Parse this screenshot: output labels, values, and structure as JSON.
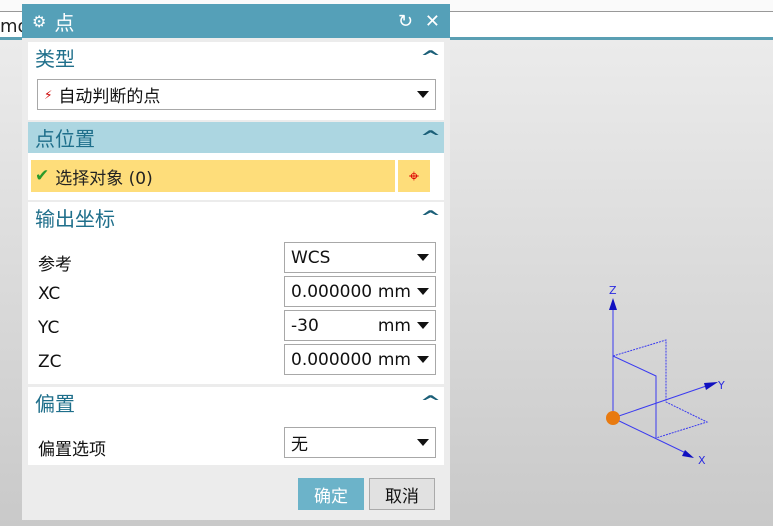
{
  "background": {
    "partial_text": "mo"
  },
  "dialog": {
    "title": "点",
    "sections": {
      "type": {
        "header": "类型",
        "selected": "自动判断的点"
      },
      "point_location": {
        "header": "点位置",
        "select_object": "选择对象 (0)"
      },
      "output_coords": {
        "header": "输出坐标",
        "reference_label": "参考",
        "reference_value": "WCS",
        "xc_label": "XC",
        "xc_value": "0.000000",
        "xc_unit": "mm",
        "yc_label": "YC",
        "yc_value": "-30",
        "yc_unit": "mm",
        "zc_label": "ZC",
        "zc_value": "0.000000",
        "zc_unit": "mm"
      },
      "offset": {
        "header": "偏置",
        "option_label": "偏置选项",
        "option_value": "无"
      }
    },
    "ok_label": "确定",
    "cancel_label": "取消"
  },
  "triad": {
    "x": "X",
    "y": "Y",
    "z": "Z"
  },
  "colors": {
    "titlebar": "#55a0b8",
    "active_header": "#acd6e1",
    "selection": "#fedd7a",
    "axis": "#2a2ae0",
    "point": "#e87a10"
  }
}
